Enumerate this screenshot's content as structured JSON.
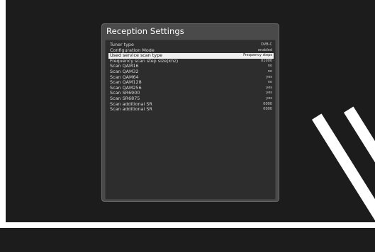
{
  "panel": {
    "title": "Reception Settings",
    "rows": [
      {
        "label": "Tuner type",
        "value": "DVB-C",
        "selected": false
      },
      {
        "label": "Configuration Mode",
        "value": "enabled",
        "selected": false
      },
      {
        "label": "Used service scan type",
        "value": "Frequency steps",
        "selected": true
      },
      {
        "label": "Frequency scan step size(khz)",
        "value": "01000",
        "selected": false
      },
      {
        "label": "Scan QAM16",
        "value": "no",
        "selected": false
      },
      {
        "label": "Scan QAM32",
        "value": "no",
        "selected": false
      },
      {
        "label": "Scan QAM64",
        "value": "yes",
        "selected": false
      },
      {
        "label": "Scan QAM128",
        "value": "no",
        "selected": false
      },
      {
        "label": "Scan QAM256",
        "value": "yes",
        "selected": false
      },
      {
        "label": "Scan SR6900",
        "value": "yes",
        "selected": false
      },
      {
        "label": "Scan SR6875",
        "value": "yes",
        "selected": false
      },
      {
        "label": "Scan additional SR",
        "value": "0000",
        "selected": false
      },
      {
        "label": "Scan additional SR",
        "value": "0000",
        "selected": false
      }
    ]
  },
  "colors": {
    "background": "#1c1c1c",
    "panel": "#4a4a4a",
    "list": "#2d2d2d",
    "selected_row": "#efefef"
  }
}
